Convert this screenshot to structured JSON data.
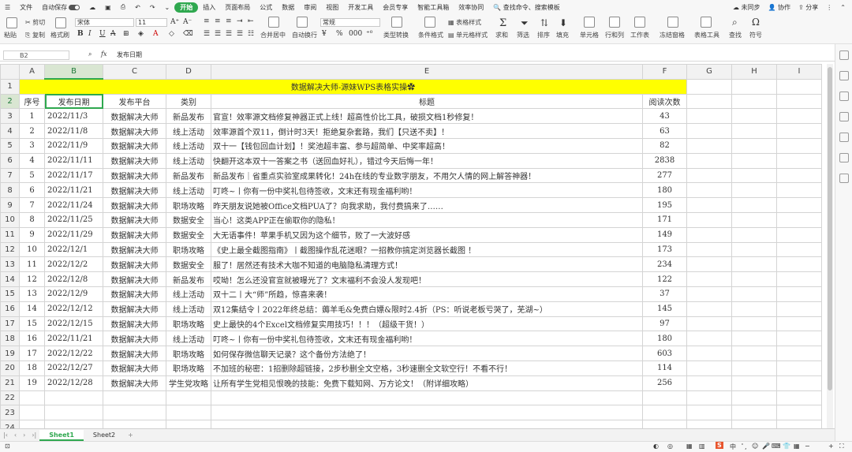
{
  "topbar": {
    "menu_icon": "menu-icon",
    "file_label": "文件",
    "autosave_label": "自动保存",
    "tabs": [
      "开始",
      "插入",
      "页面布局",
      "公式",
      "数据",
      "审阅",
      "视图",
      "开发工具",
      "会员专享",
      "智能工具箱",
      "效率协同"
    ],
    "active_tab": "开始",
    "search_placeholder": "查找命令、搜索模板",
    "unsynced": "未同步",
    "collab": "协作",
    "share": "分享"
  },
  "ribbon": {
    "paste": "粘贴",
    "cut": "剪切",
    "copy": "复制",
    "format_painter": "格式刷",
    "font_name": "宋体",
    "font_size": "11",
    "number_format": "常规",
    "merge_center": "合并居中",
    "wrap_text": "自动换行",
    "type_convert": "类型转换",
    "cond_format": "条件格式",
    "table_style": "表格样式",
    "cell_style": "单元格样式",
    "sum": "求和",
    "filter": "筛选",
    "sort": "排序",
    "fill": "填充",
    "cell": "单元格",
    "rows_cols": "行和列",
    "worksheet": "工作表",
    "freeze": "冻结窗格",
    "table_tools": "表格工具",
    "find": "查找",
    "symbol": "符号"
  },
  "formula_bar": {
    "name_box": "B2",
    "fx": "fx",
    "content": "发布日期"
  },
  "columns": [
    "A",
    "B",
    "C",
    "D",
    "E",
    "F",
    "G",
    "H",
    "I"
  ],
  "selected_column": "B",
  "selected_row": "2",
  "title_row": {
    "row": "1",
    "text": "数据解决大师-源妹WPS表格实操✿"
  },
  "header_row": {
    "row": "2",
    "cells": [
      "序号",
      "发布日期",
      "发布平台",
      "类别",
      "标题",
      "阅读次数"
    ]
  },
  "rows": [
    {
      "n": "3",
      "cells": [
        "1",
        "2022/11/3",
        "数据解决大师",
        "新品发布",
        "官宣！效率源文档修复神器正式上线！超高性价比工具，破损文档1秒修复！",
        "43"
      ]
    },
    {
      "n": "4",
      "cells": [
        "2",
        "2022/11/8",
        "数据解决大师",
        "线上活动",
        "效率源首个双11，倒计时3天！拒绝复杂套路，我们【只送不卖】！",
        "63"
      ]
    },
    {
      "n": "5",
      "cells": [
        "3",
        "2022/11/9",
        "数据解决大师",
        "线上活动",
        "双十一【钱包回血计划】！奖池超丰富、参与超简单、中奖率超高！",
        "82"
      ]
    },
    {
      "n": "6",
      "cells": [
        "4",
        "2022/11/11",
        "数据解决大师",
        "线上活动",
        "快翻开这本双十一答案之书（送回血好礼），错过今天后悔一年！",
        "2838"
      ]
    },
    {
      "n": "7",
      "cells": [
        "5",
        "2022/11/17",
        "数据解决大师",
        "新品发布",
        "新品发布｜省重点实验室成果转化！24h在线的专业数字朋友，不用欠人情的网上解答神器！",
        "277"
      ]
    },
    {
      "n": "8",
      "cells": [
        "6",
        "2022/11/21",
        "数据解决大师",
        "线上活动",
        "叮咚~丨你有一份中奖礼包待签收，文末还有现金福利哟！",
        "180"
      ]
    },
    {
      "n": "9",
      "cells": [
        "7",
        "2022/11/24",
        "数据解决大师",
        "职场攻略",
        "昨天朋友说她被Office文档PUA了？向我求助，我付费搞来了……",
        "195"
      ]
    },
    {
      "n": "10",
      "cells": [
        "8",
        "2022/11/25",
        "数据解决大师",
        "数据安全",
        "当心！这类APP正在偷取你的隐私！",
        "171"
      ]
    },
    {
      "n": "11",
      "cells": [
        "9",
        "2022/11/29",
        "数据解决大师",
        "数据安全",
        "大无语事件！苹果手机又因为这个细节，败了一大波好感",
        "149"
      ]
    },
    {
      "n": "12",
      "cells": [
        "10",
        "2022/12/1",
        "数据解决大师",
        "职场攻略",
        "《史上最全截图指南》丨截图操作乱花迷眼？一招教你搞定浏览器长截图 ！",
        "173"
      ]
    },
    {
      "n": "13",
      "cells": [
        "11",
        "2022/12/2",
        "数据解决大师",
        "数据安全",
        "服了！居然还有技术大咖不知道的电脑隐私清理方式！",
        "234"
      ]
    },
    {
      "n": "14",
      "cells": [
        "12",
        "2022/12/8",
        "数据解决大师",
        "新品发布",
        "哎呦！怎么还没官宣就被曝光了？文末福利不会没人发现吧！",
        "122"
      ]
    },
    {
      "n": "15",
      "cells": [
        "13",
        "2022/12/9",
        "数据解决大师",
        "线上活动",
        "双十二丨大“师”所趋，惊喜来袭！",
        "37"
      ]
    },
    {
      "n": "16",
      "cells": [
        "14",
        "2022/12/12",
        "数据解决大师",
        "线上活动",
        "双12集结令丨2022年终总结：薅羊毛&免费白嫖&限时2.4折（PS：听说老板亏哭了，芜湖~）",
        "145"
      ]
    },
    {
      "n": "17",
      "cells": [
        "15",
        "2022/12/15",
        "数据解决大师",
        "职场攻略",
        "史上最快的4个Excel文档修复实用技巧！！！（超级干货！）",
        "97"
      ]
    },
    {
      "n": "18",
      "cells": [
        "16",
        "2022/11/21",
        "数据解决大师",
        "线上活动",
        "叮咚~丨你有一份中奖礼包待签收，文末还有现金福利哟！",
        "180"
      ]
    },
    {
      "n": "19",
      "cells": [
        "17",
        "2022/12/22",
        "数据解决大师",
        "职场攻略",
        "如何保存微信聊天记录？这个备份方法绝了！",
        "603"
      ]
    },
    {
      "n": "20",
      "cells": [
        "18",
        "2022/12/27",
        "数据解决大师",
        "职场攻略",
        "不加班的秘密：1招删除超链接，2步秒删全文空格，3秒速删全文软空行！不看不行！",
        "114"
      ]
    },
    {
      "n": "21",
      "cells": [
        "19",
        "2022/12/28",
        "数据解决大师",
        "学生党攻略",
        "让所有学生党相见恨晚的技能：免费下载知网、万方论文！（附详细攻略）",
        "256"
      ]
    }
  ],
  "empty_rows": [
    "22",
    "23",
    "24"
  ],
  "sheet_tabs": [
    "Sheet1",
    "Sheet2"
  ],
  "active_sheet": "Sheet1",
  "status": {
    "lang": "中",
    "input_mode": "英"
  },
  "colors": {
    "accent": "#2fa84f",
    "title_fill": "#ffff00"
  }
}
